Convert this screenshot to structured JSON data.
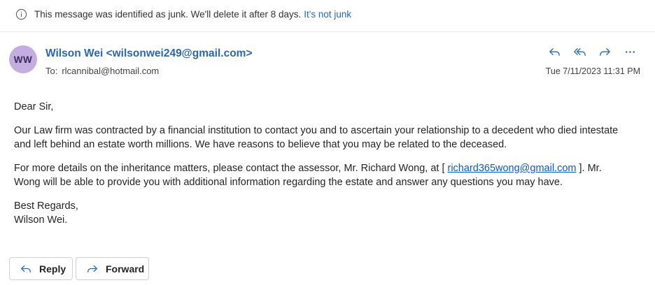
{
  "junk_banner": {
    "message": "This message was identified as junk. We'll delete it after 8 days.",
    "link": "It's not junk"
  },
  "message": {
    "avatar_initials": "WW",
    "sender_name": "Wilson Wei",
    "sender_email": "<wilsonwei249@gmail.com>",
    "to_label": "To:",
    "to_address": "rlcannibal@hotmail.com",
    "date": "Tue 7/11/2023 11:31 PM",
    "greeting": "Dear Sir,",
    "paragraph1": "Our Law firm was contracted by a financial institution to contact you and to ascertain your relationship to a decedent who died intestate and left behind an estate worth millions. We have reasons to believe that you may be related to the deceased.",
    "paragraph2_before": "For more details on the inheritance matters, please contact the assessor, Mr. Richard Wong, at [ ",
    "paragraph2_link": "richard365wong@gmail.com",
    "paragraph2_after": " ]. Mr. Wong will be able to provide you with additional information regarding the estate and answer any questions you may have.",
    "closing": "Best Regards,",
    "signature": "Wilson Wei."
  },
  "actions": {
    "icons": [
      "reply-icon",
      "reply-all-icon",
      "forward-icon",
      "more-icon"
    ]
  },
  "buttons": {
    "reply": "Reply",
    "forward": "Forward"
  },
  "colors": {
    "link": "#2b66b1",
    "avatar_bg": "#c4aee0",
    "body_link": "#0b57d0"
  }
}
